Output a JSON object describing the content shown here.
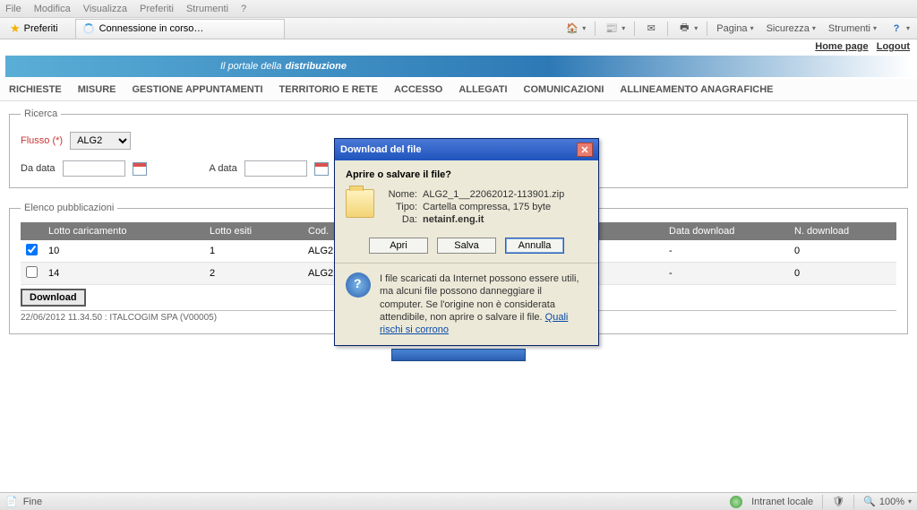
{
  "ie_menu": [
    "File",
    "Modifica",
    "Visualizza",
    "Preferiti",
    "Strumenti",
    "?"
  ],
  "favorites_label": "Preferiti",
  "tab_label": "Connessione in corso…",
  "toolbar_menus": {
    "pagina": "Pagina",
    "sicurezza": "Sicurezza",
    "strumenti": "Strumenti"
  },
  "toplinks": {
    "home": "Home page",
    "logout": "Logout"
  },
  "banner": {
    "pre": "Il portale della ",
    "strong": "distribuzione"
  },
  "portal_menu": [
    "RICHIESTE",
    "MISURE",
    "GESTIONE APPUNTAMENTI",
    "TERRITORIO E RETE",
    "ACCESSO",
    "ALLEGATI",
    "COMUNICAZIONI",
    "ALLINEAMENTO ANAGRAFICHE"
  ],
  "search": {
    "legend": "Ricerca",
    "flusso_label": "Flusso (*)",
    "flusso_value": "ALG2",
    "da_data_label": "Da data",
    "a_data_label": "A data",
    "da_data_value": "",
    "a_data_value": ""
  },
  "pubs": {
    "legend": "Elenco pubblicazioni",
    "headers": {
      "lotto_car": "Lotto caricamento",
      "lotto_es": "Lotto esiti",
      "cod": "Cod.",
      "data_dl": "Data download",
      "n_dl": "N. download"
    },
    "rows": [
      {
        "checked": true,
        "lotto_car": "10",
        "lotto_es": "1",
        "cod": "ALG2",
        "data_dl": "-",
        "n_dl": "0"
      },
      {
        "checked": false,
        "lotto_car": "14",
        "lotto_es": "2",
        "cod": "ALG2",
        "data_dl": "-",
        "n_dl": "0"
      }
    ],
    "download_btn": "Download"
  },
  "footer_line": "22/06/2012 11.34.50   :   ITALCOGIM SPA   (V00005)",
  "dialog": {
    "title": "Download del file",
    "question": "Aprire o salvare il file?",
    "name_k": "Nome:",
    "name_v": "ALG2_1__22062012-113901.zip",
    "type_k": "Tipo:",
    "type_v": "Cartella compressa, 175 byte",
    "from_k": "Da:",
    "from_v": "netainf.eng.it",
    "btn_open": "Apri",
    "btn_save": "Salva",
    "btn_cancel": "Annulla",
    "warn_pre": "I file scaricati da Internet possono essere utili, ma alcuni file possono danneggiare il computer. Se l'origine non è considerata attendibile, non aprire o salvare il file. ",
    "warn_link": "Quali rischi si corrono"
  },
  "status": {
    "left": "Fine",
    "zone": "Intranet locale",
    "zoom": "100%"
  }
}
